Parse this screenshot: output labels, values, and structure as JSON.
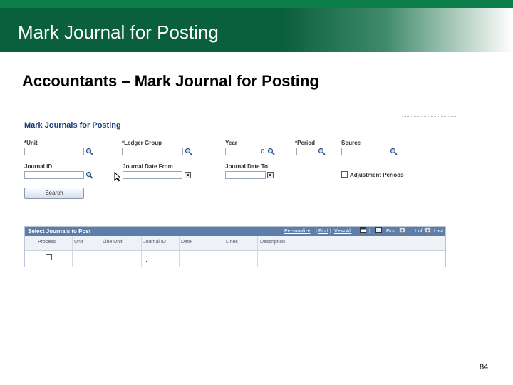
{
  "slide": {
    "banner_title": "Mark Journal for Posting",
    "subtitle": "Accountants – Mark Journal for Posting",
    "page_number": "84"
  },
  "ps_page": {
    "title": "Mark Journals for Posting",
    "fields": {
      "unit": "*Unit",
      "ledger_group": "*Ledger Group",
      "year": "Year",
      "year_value": "0",
      "period": "*Period",
      "source": "Source",
      "journal_id": "Journal ID",
      "journal_date_from": "Journal Date From",
      "journal_date_to": "Journal Date To",
      "adjustment_periods": "Adjustment Periods"
    },
    "search_button": "Search"
  },
  "grid": {
    "title": "Select Journals to Post",
    "personalize": "Personalize",
    "find": "Find",
    "view_all": "View All",
    "first": "First",
    "count": "1 of 1",
    "last": "Last",
    "columns": [
      "Process",
      "Unit",
      "Line Unit",
      "Journal ID",
      "Date",
      "Lines",
      "Description"
    ]
  },
  "colors": {
    "banner_green": "#0a5f3c",
    "topbar_green": "#0b7d48",
    "grid_header": "#5c7ea8",
    "ps_title": "#1c3c7c"
  }
}
